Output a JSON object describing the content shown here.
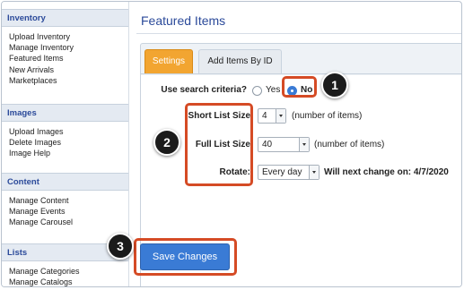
{
  "sidebar": {
    "sections": [
      {
        "title": "Inventory",
        "items": [
          "Upload Inventory",
          "Manage Inventory",
          "Featured Items",
          "New Arrivals",
          "Marketplaces"
        ]
      },
      {
        "title": "Images",
        "items": [
          "Upload Images",
          "Delete Images",
          "Image Help"
        ]
      },
      {
        "title": "Content",
        "items": [
          "Manage Content",
          "Manage Events",
          "Manage Carousel"
        ]
      },
      {
        "title": "Lists",
        "items": [
          "Manage Categories",
          "Manage Catalogs"
        ]
      }
    ]
  },
  "main": {
    "title": "Featured Items",
    "tabs": [
      {
        "label": "Settings",
        "active": true
      },
      {
        "label": "Add Items By ID",
        "active": false
      }
    ],
    "form": {
      "search_criteria": {
        "label": "Use search criteria?",
        "options": [
          "Yes",
          "No"
        ],
        "selected": "No"
      },
      "short_list_size": {
        "label": "Short List Size",
        "value": "4",
        "suffix": "(number of items)"
      },
      "full_list_size": {
        "label": "Full List Size",
        "value": "40",
        "suffix": "(number of items)"
      },
      "rotate": {
        "label": "Rotate:",
        "value": "Every day",
        "note": "Will next change on: 4/7/2020"
      }
    },
    "save_label": "Save Changes"
  },
  "callouts": [
    "1",
    "2",
    "3"
  ],
  "colors": {
    "accent": "#3a7bd5",
    "tab_active": "#f2a531",
    "heading": "#2b4a9a",
    "highlight": "#d54b25"
  }
}
